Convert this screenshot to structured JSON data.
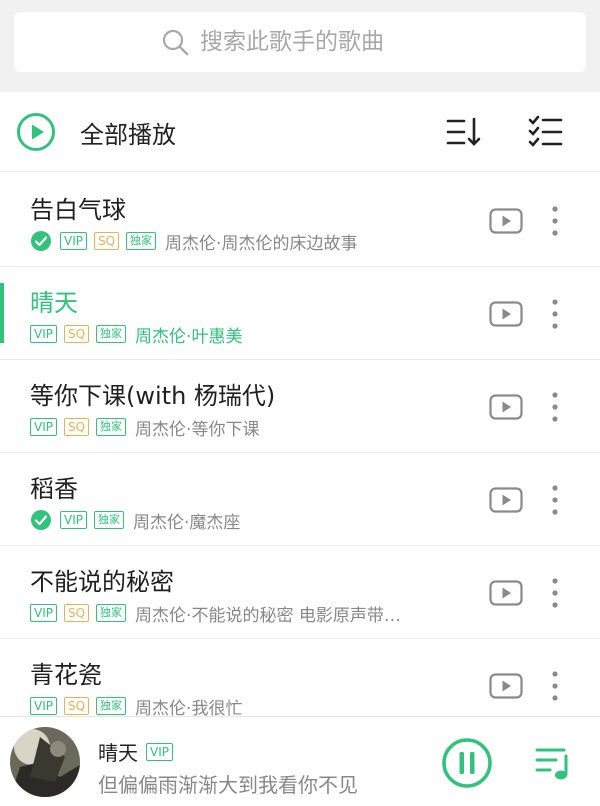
{
  "search": {
    "placeholder": "搜索此歌手的歌曲"
  },
  "toolbar": {
    "play_all_label": "全部播放"
  },
  "songs": [
    {
      "title": "告白气球",
      "downloaded": true,
      "vip": "VIP",
      "sq": "SQ",
      "exclusive": "独家",
      "artist_album": "周杰伦·周杰伦的床边故事"
    },
    {
      "title": "晴天",
      "downloaded": false,
      "vip": "VIP",
      "sq": "SQ",
      "exclusive": "独家",
      "artist_album": "周杰伦·叶惠美",
      "playing": true
    },
    {
      "title": "等你下课(with 杨瑞代)",
      "downloaded": false,
      "vip": "VIP",
      "sq": "SQ",
      "exclusive": "独家",
      "artist_album": "周杰伦·等你下课"
    },
    {
      "title": "稻香",
      "downloaded": true,
      "vip": "VIP",
      "exclusive": "独家",
      "artist_album": "周杰伦·魔杰座"
    },
    {
      "title": "不能说的秘密",
      "downloaded": false,
      "vip": "VIP",
      "sq": "SQ",
      "exclusive": "独家",
      "artist_album": "周杰伦·不能说的秘密 电影原声带…"
    },
    {
      "title": "青花瓷",
      "downloaded": false,
      "vip": "VIP",
      "sq": "SQ",
      "exclusive": "独家",
      "artist_album": "周杰伦·我很忙"
    }
  ],
  "player": {
    "title": "晴天",
    "vip": "VIP",
    "lyric": "但偏偏雨渐渐大到我看你不见"
  },
  "colors": {
    "accent": "#31c27c",
    "sq": "#e8b250",
    "text_secondary": "#888888"
  },
  "icons": {
    "search": "search-icon",
    "play_all": "play-circle-icon",
    "sort": "sort-icon",
    "multi_select": "multi-select-icon",
    "mv": "mv-video-icon",
    "more": "more-vertical-icon",
    "downloaded": "downloaded-check-icon",
    "pause": "pause-icon",
    "queue": "playlist-icon"
  }
}
